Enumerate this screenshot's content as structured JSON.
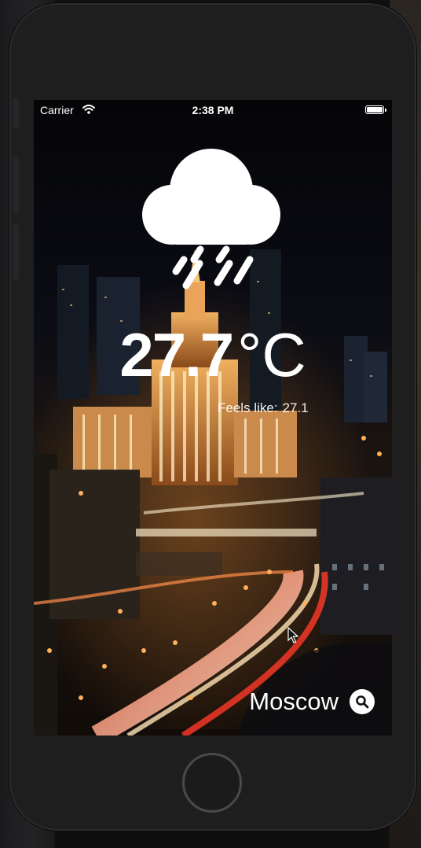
{
  "status_bar": {
    "carrier": "Carrier",
    "time": "2:38 PM",
    "wifi_icon": "wifi-icon",
    "battery_icon": "battery-full-icon"
  },
  "weather": {
    "condition_icon": "cloud-rain-icon",
    "temperature": "27.7",
    "unit": "°C",
    "feels_like_label": "Feels like",
    "feels_like_value": "27.1"
  },
  "location": {
    "city": "Moscow",
    "search_icon": "search-icon"
  },
  "device": {
    "home_button": "home-button"
  }
}
